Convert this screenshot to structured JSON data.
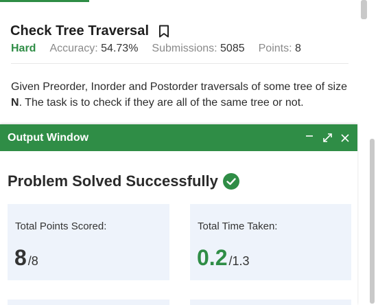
{
  "problem": {
    "title": "Check Tree Traversal",
    "difficulty": "Hard",
    "accuracy_label": "Accuracy:",
    "accuracy_value": "54.73%",
    "submissions_label": "Submissions:",
    "submissions_value": "5085",
    "points_label": "Points:",
    "points_value": "8",
    "description_before": "Given Preorder, Inorder and Postorder traversals of some tree of size ",
    "description_var": "N",
    "description_after": ". The task is to check if they are all of the same tree or not."
  },
  "output_window": {
    "title": "Output Window",
    "result_title": "Problem Solved Successfully",
    "cards": [
      {
        "label": "Total Points Scored:",
        "value": "8",
        "total": "/8"
      },
      {
        "label": "Total Time Taken:",
        "value": "0.2",
        "total": "/1.3"
      }
    ]
  },
  "icons": {
    "bookmark": "bookmark-icon",
    "minimize": "minimize-icon",
    "expand": "expand-icon",
    "close": "close-icon",
    "success": "check-circle-icon"
  },
  "colors": {
    "accent": "#2f8d46",
    "card_bg": "#eef3fb"
  }
}
